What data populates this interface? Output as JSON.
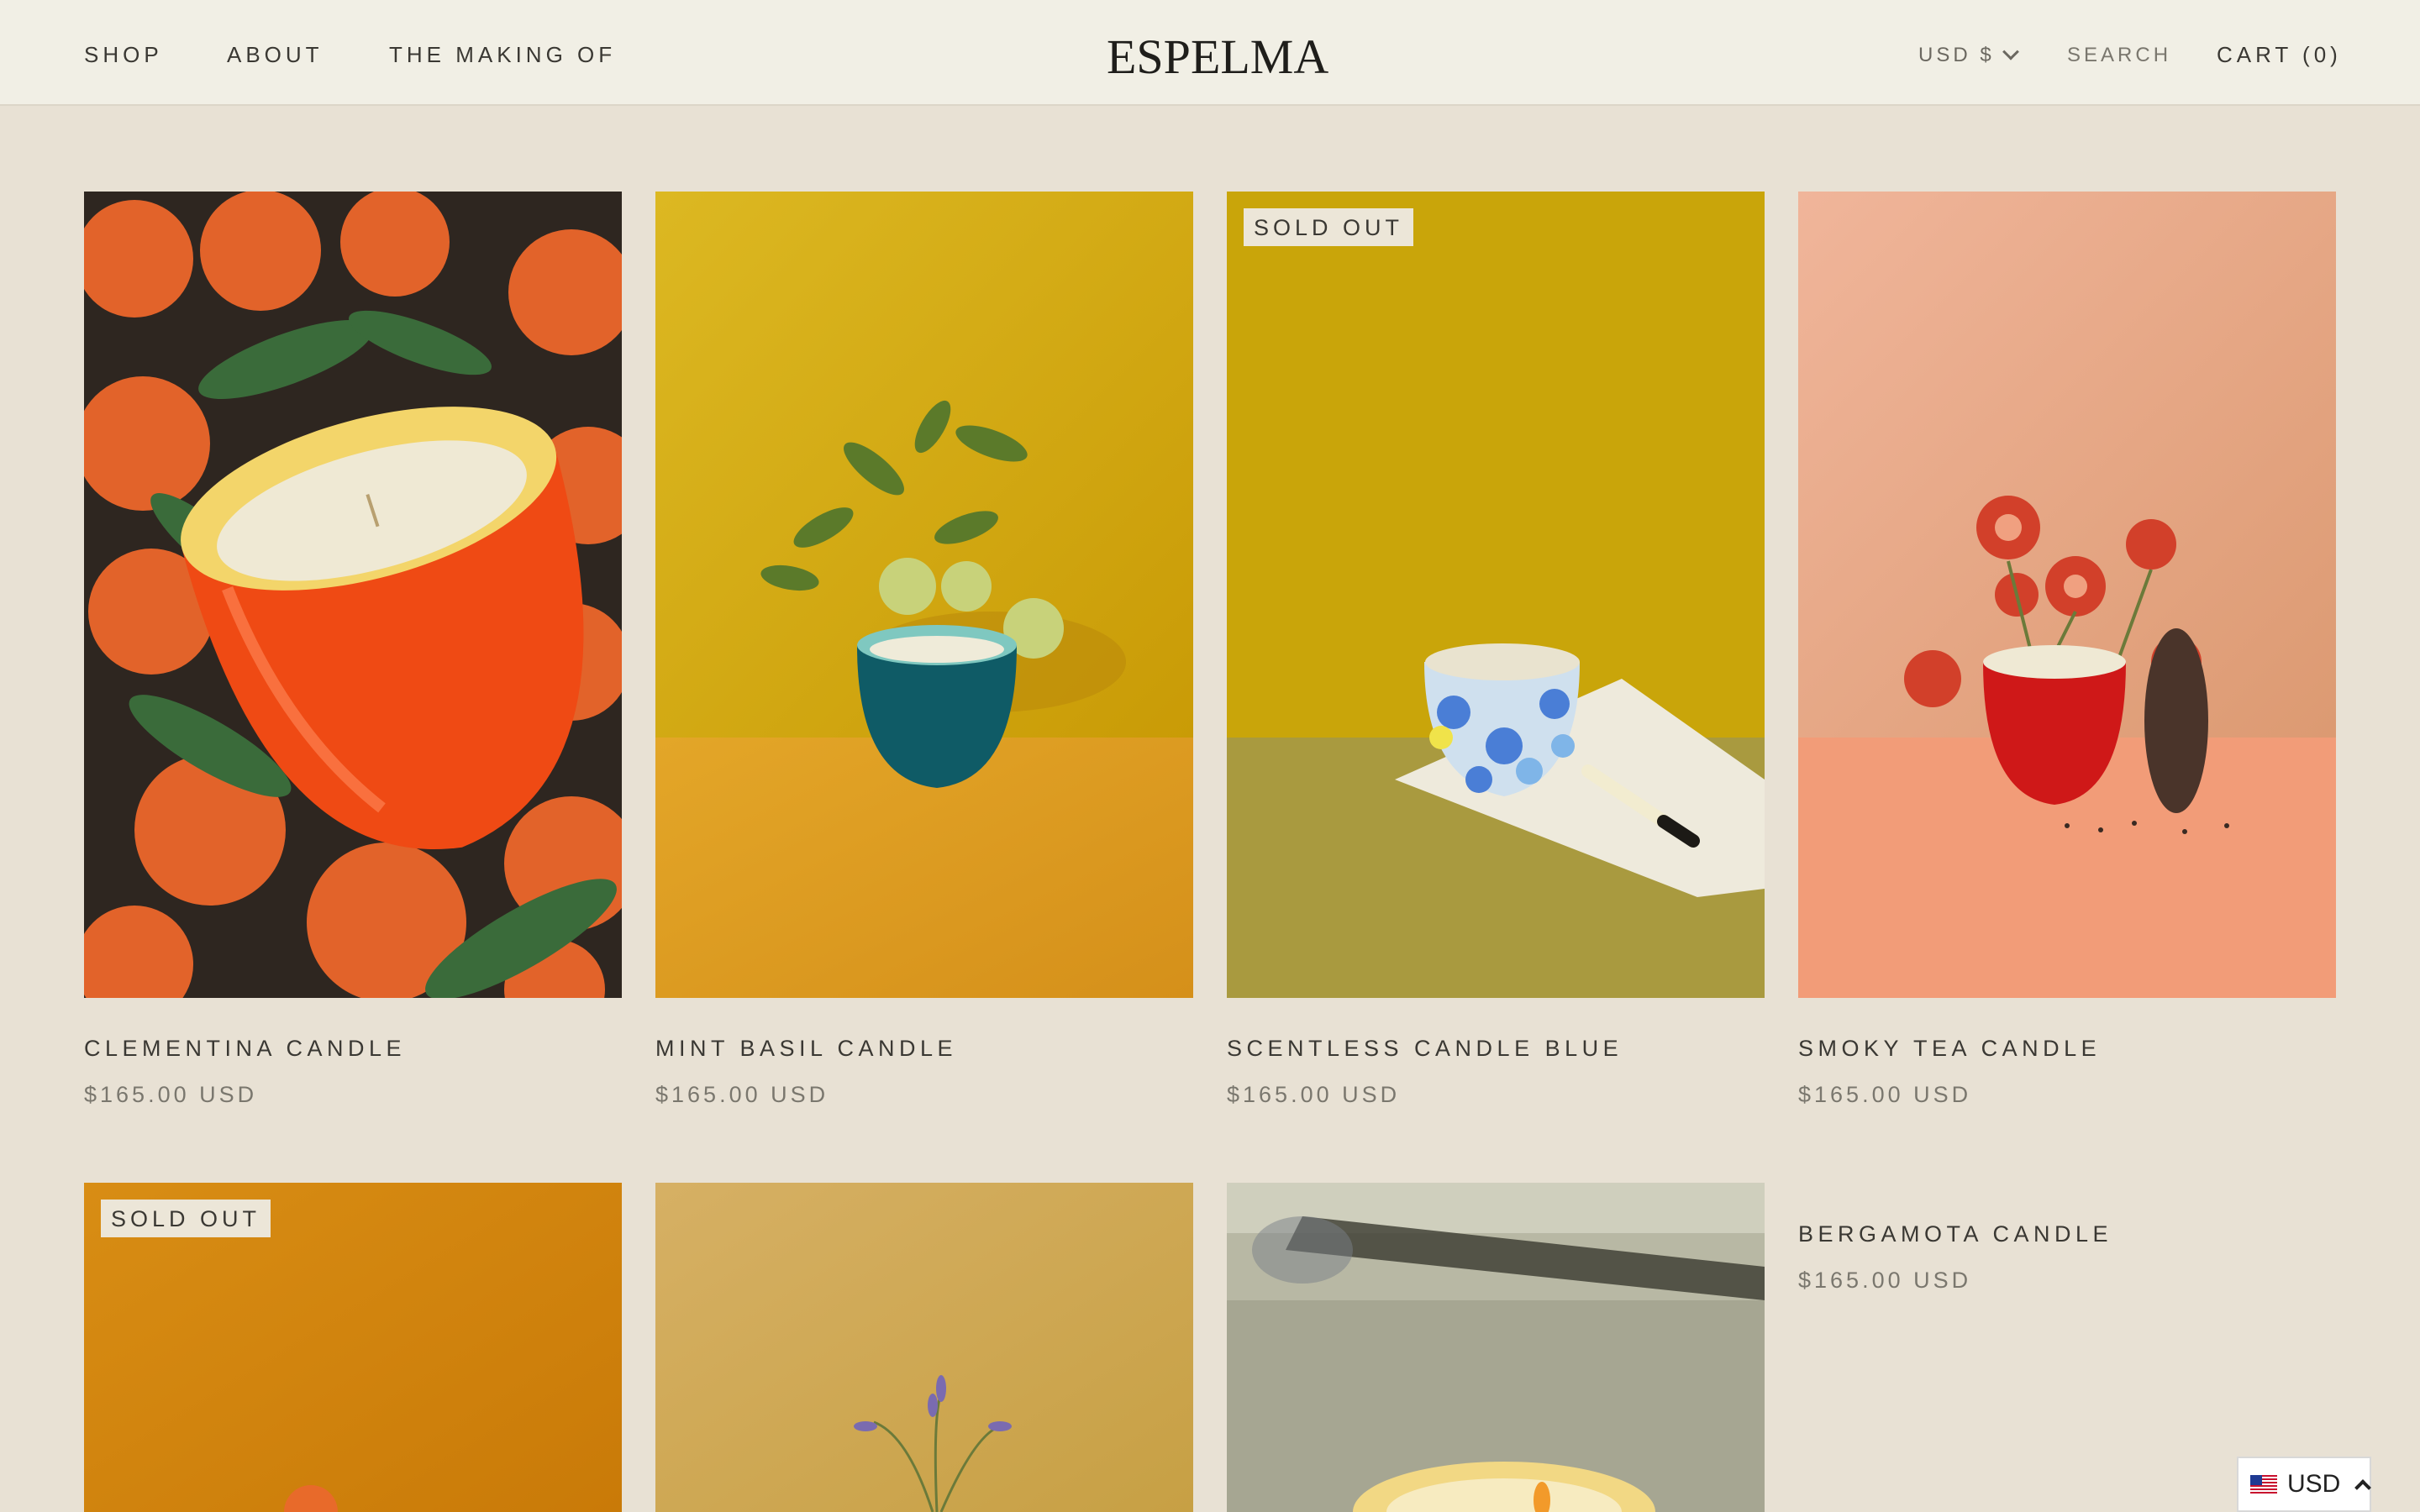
{
  "header": {
    "nav_left": [
      "SHOP",
      "ABOUT",
      "THE MAKING OF"
    ],
    "logo": "ESPELMA",
    "currency": "USD $",
    "search": "SEARCH",
    "cart": "CART (0)"
  },
  "products": [
    {
      "title": "CLEMENTINA CANDLE",
      "price": "$165.00 USD",
      "badge": ""
    },
    {
      "title": "MINT BASIL CANDLE",
      "price": "$165.00 USD",
      "badge": ""
    },
    {
      "title": "SCENTLESS CANDLE BLUE",
      "price": "$165.00 USD",
      "badge": "SOLD OUT"
    },
    {
      "title": "SMOKY TEA CANDLE",
      "price": "$165.00 USD",
      "badge": ""
    },
    {
      "title": "",
      "price": "",
      "badge": "SOLD OUT"
    },
    {
      "title": "",
      "price": "",
      "badge": ""
    },
    {
      "title": "",
      "price": "",
      "badge": ""
    },
    {
      "title": "BERGAMOTA CANDLE",
      "price": "$165.00 USD",
      "badge": ""
    }
  ],
  "currency_widget": {
    "label": "USD",
    "flag_icon": "us-flag-icon",
    "toggle_icon": "chevron-up-icon"
  },
  "colors": {
    "header_bg": "#f1efe5",
    "page_bg": "#e8e1d4",
    "text": "#3a3833",
    "muted": "#7a776e"
  }
}
